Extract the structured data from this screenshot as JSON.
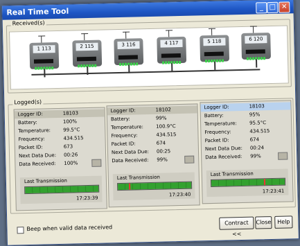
{
  "window": {
    "title": "Real Time Tool"
  },
  "received": {
    "label": "Received(s)",
    "devices": [
      {
        "id": "1",
        "label": "113"
      },
      {
        "id": "2",
        "label": "115"
      },
      {
        "id": "3",
        "label": "116"
      },
      {
        "id": "4",
        "label": "117"
      },
      {
        "id": "5",
        "label": "118"
      },
      {
        "id": "6",
        "label": "120"
      }
    ]
  },
  "logged": {
    "label": "Logged(s)",
    "field_labels": {
      "logger_id": "Logger ID:",
      "battery": "Battery:",
      "temperature": "Temperature:",
      "frequency": "Frequency:",
      "packet_id": "Packet ID:",
      "next_data_due": "Next Data Due:",
      "data_received": "Data Received:",
      "last_transmission": "Last Transmission"
    },
    "loggers": [
      {
        "logger_id": "18103",
        "battery": "100%",
        "temperature": "99.5°C",
        "frequency": "434.515",
        "packet_id": "673",
        "next_data_due": "00:26",
        "data_received": "100%",
        "time": "17:23:39"
      },
      {
        "logger_id": "18102",
        "battery": "99%",
        "temperature": "100.9°C",
        "frequency": "434.515",
        "packet_id": "674",
        "next_data_due": "00:25",
        "data_received": "99%",
        "time": "17:23:40"
      },
      {
        "logger_id": "18103",
        "battery": "95%",
        "temperature": "95.5°C",
        "frequency": "434.515",
        "packet_id": "674",
        "next_data_due": "00:24",
        "data_received": "99%",
        "time": "17:23:41"
      }
    ]
  },
  "options": {
    "beep_label": "Beep when valid data received",
    "beep_checked": false
  },
  "buttons": {
    "contract": "Contract <<",
    "close": "Close",
    "help": "Help"
  }
}
